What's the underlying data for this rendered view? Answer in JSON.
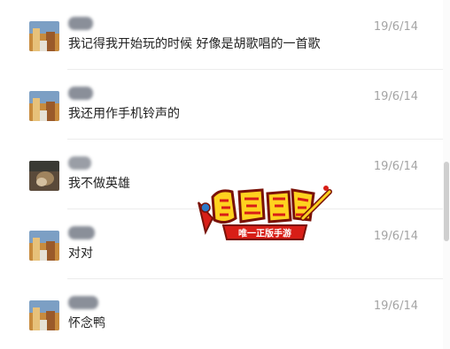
{
  "comments": [
    {
      "text": "我记得我开始玩的时候 好像是胡歌唱的一首歌",
      "date": "19/6/14"
    },
    {
      "text": "我还用作手机铃声的",
      "date": "19/6/14"
    },
    {
      "text": "我不做英雄",
      "date": "19/6/14"
    },
    {
      "text": "对对",
      "date": "19/6/14"
    },
    {
      "text": "怀念鸭",
      "date": "19/6/14"
    }
  ],
  "watermark": {
    "slogan": "唯一正版手游",
    "brand_colors": [
      "#ffd21f",
      "#d81e17",
      "#7a1208"
    ]
  },
  "avatar_colors": {
    "blue_sky": "#6d8fb4",
    "warm": "#c78a3a",
    "dark": "#5b4a3a"
  }
}
